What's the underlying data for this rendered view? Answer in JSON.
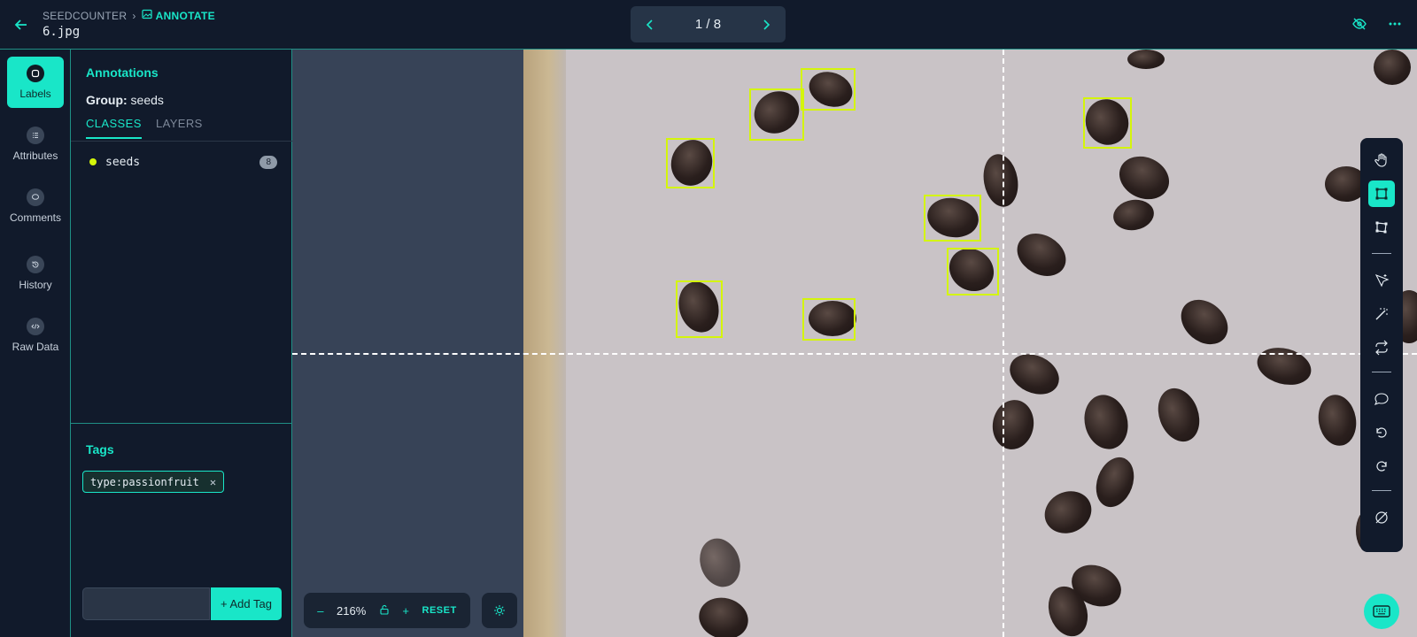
{
  "header": {
    "breadcrumb_project": "SEEDCOUNTER",
    "breadcrumb_mode": "ANNOTATE",
    "filename": "6.jpg",
    "pager_text": "1 / 8"
  },
  "nav": {
    "items": [
      {
        "label": "Labels",
        "icon": "label-icon"
      },
      {
        "label": "Attributes",
        "icon": "list-icon"
      },
      {
        "label": "Comments",
        "icon": "comment-icon"
      },
      {
        "label": "History",
        "icon": "history-icon"
      },
      {
        "label": "Raw Data",
        "icon": "code-icon"
      }
    ]
  },
  "panel": {
    "title": "Annotations",
    "group_label": "Group:",
    "group_value": "seeds",
    "tabs": [
      "CLASSES",
      "LAYERS"
    ],
    "classes": [
      {
        "name": "seeds",
        "count": "8",
        "color": "#d4f50a"
      }
    ],
    "tags_title": "Tags",
    "tags": [
      "type:passionfruit"
    ],
    "tag_input_placeholder": "",
    "add_tag_label": "+ Add Tag"
  },
  "viewer": {
    "zoom_level": "216%",
    "reset_label": "RESET"
  },
  "colors": {
    "accent": "#19e6c8",
    "bbox": "#d4f50a",
    "background": "#111a2b"
  }
}
